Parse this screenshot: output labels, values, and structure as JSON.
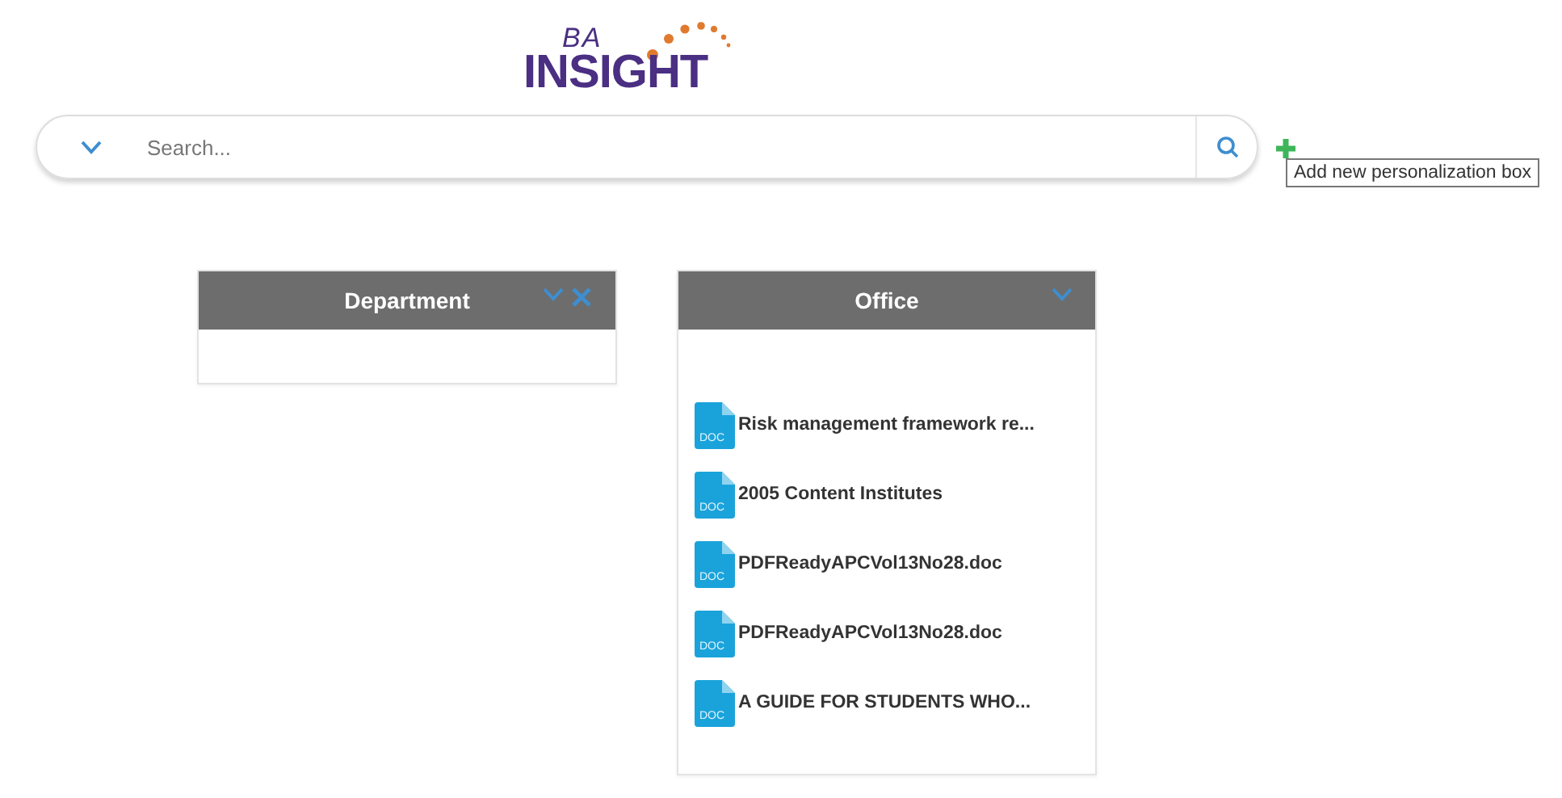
{
  "logo": {
    "top": "BA",
    "main": "INSIGHT"
  },
  "search": {
    "placeholder": "Search..."
  },
  "add_button": {
    "tooltip": "Add new personalization box"
  },
  "boxes": [
    {
      "title": "Department",
      "closable": true
    },
    {
      "title": "Office",
      "closable": false,
      "items": [
        {
          "label": "Risk management framework re...",
          "icon_label": "DOC"
        },
        {
          "label": "2005 Content Institutes",
          "icon_label": "DOC"
        },
        {
          "label": "PDFReadyAPCVol13No28.doc",
          "icon_label": "DOC"
        },
        {
          "label": "PDFReadyAPCVol13No28.doc",
          "icon_label": "DOC"
        },
        {
          "label": "A GUIDE FOR STUDENTS WHO...",
          "icon_label": "DOC"
        }
      ]
    }
  ]
}
